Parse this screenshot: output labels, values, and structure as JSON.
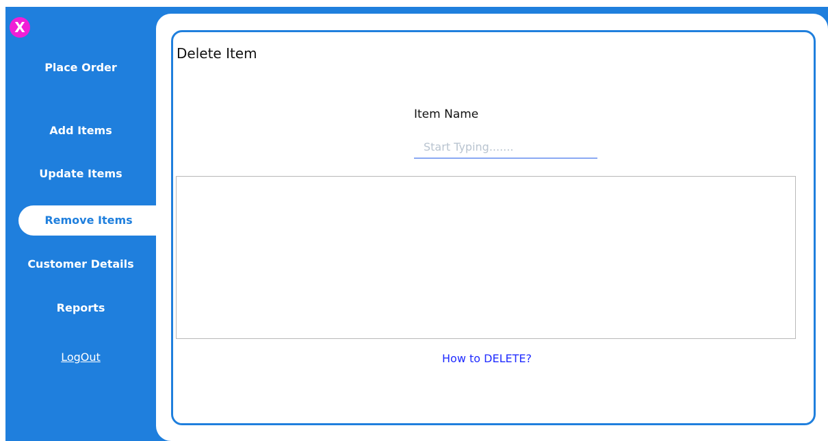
{
  "sidebar": {
    "close_label": "X",
    "items": [
      {
        "label": "Place Order"
      },
      {
        "label": "Add Items"
      },
      {
        "label": "Update Items"
      },
      {
        "label": "Remove Items"
      },
      {
        "label": "Customer Details"
      },
      {
        "label": "Reports"
      }
    ],
    "logout_label": "LogOut",
    "active_item": "Remove Items"
  },
  "main": {
    "title": "Delete Item",
    "item_name_label": "Item Name",
    "item_name_placeholder": "Start Typing.......",
    "item_name_value": "",
    "help_link": "How to DELETE?"
  },
  "colors": {
    "sidebar_background": "#1f7fdd",
    "close_button": "#f01fd6",
    "active_item_background": "#ffffff",
    "input_underline": "#8aa9f3",
    "help_link": "#1f2bff"
  }
}
